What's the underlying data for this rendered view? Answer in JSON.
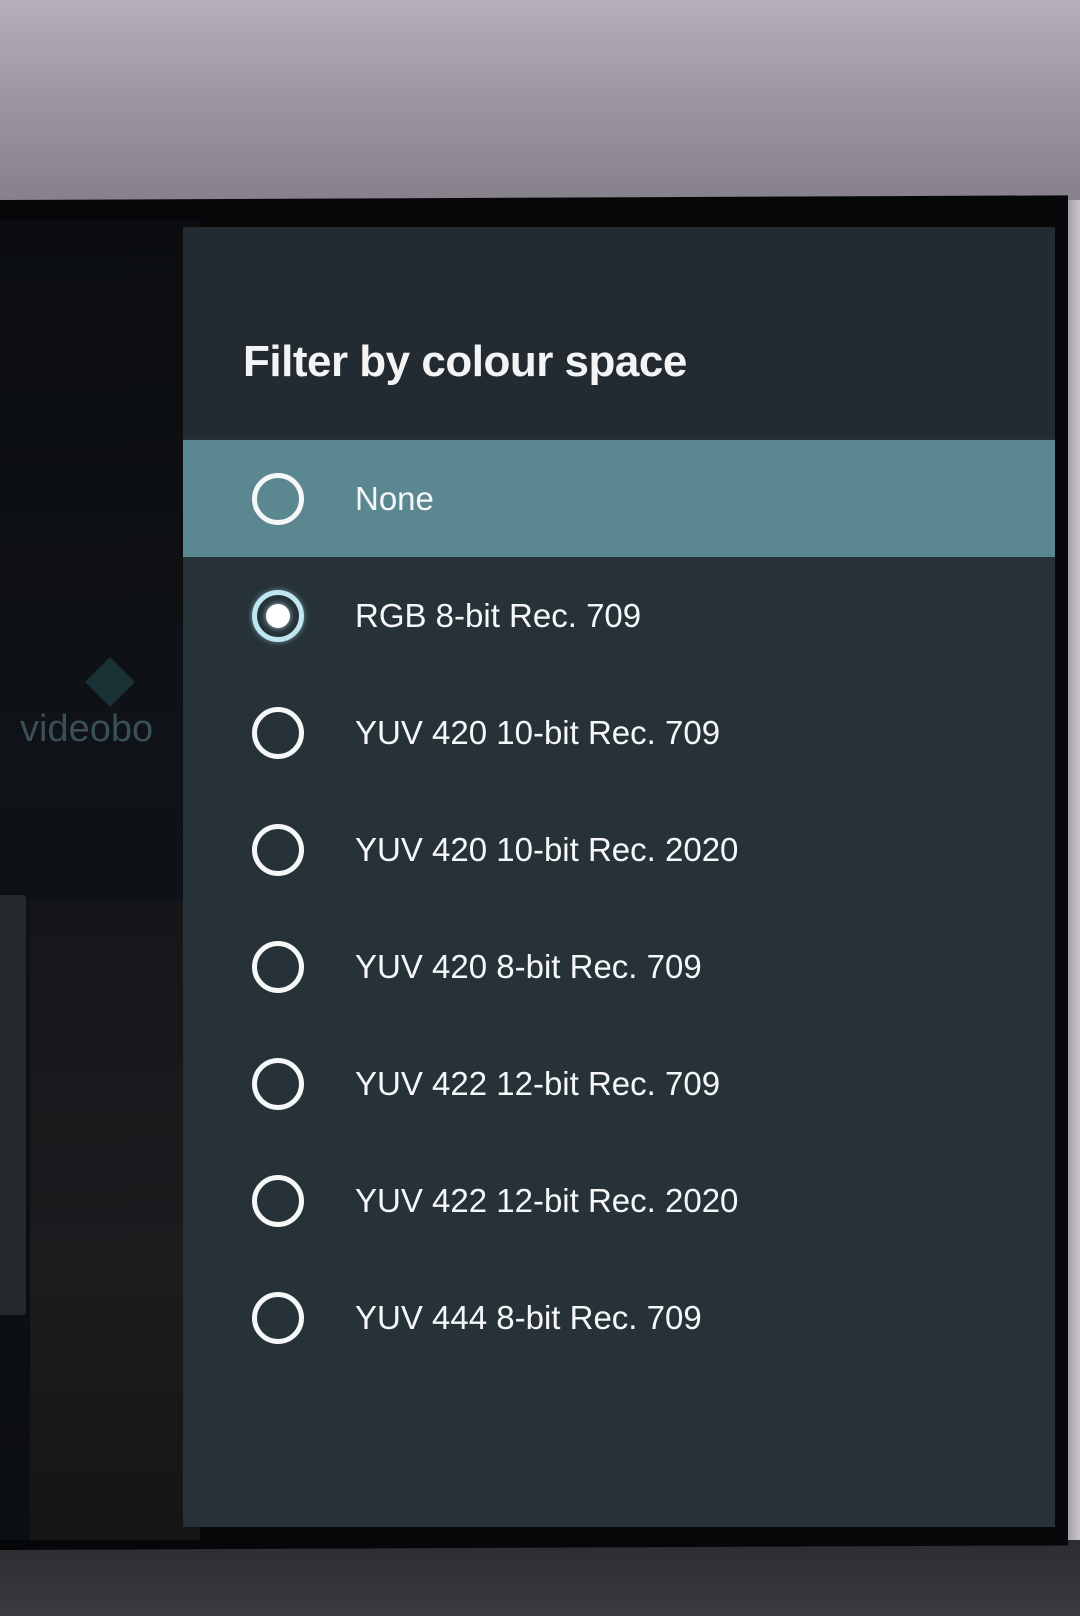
{
  "dialog": {
    "title": "Filter by colour space",
    "options": [
      {
        "label": "None",
        "selected": false,
        "focused": true
      },
      {
        "label": "RGB 8-bit Rec. 709",
        "selected": true,
        "focused": false
      },
      {
        "label": "YUV 420 10-bit Rec. 709",
        "selected": false,
        "focused": false
      },
      {
        "label": "YUV 420 10-bit Rec. 2020",
        "selected": false,
        "focused": false
      },
      {
        "label": "YUV 420 8-bit Rec. 709",
        "selected": false,
        "focused": false
      },
      {
        "label": "YUV 422 12-bit Rec. 709",
        "selected": false,
        "focused": false
      },
      {
        "label": "YUV 422 12-bit Rec. 2020",
        "selected": false,
        "focused": false
      },
      {
        "label": "YUV 444 8-bit Rec. 709",
        "selected": false,
        "focused": false
      }
    ]
  },
  "background_app": {
    "logo_text": "videobo"
  },
  "colors": {
    "dialog_background": "#263238",
    "header_background": "#212b31",
    "focused_row": "#5a8790",
    "text": "#f5f7f8"
  }
}
